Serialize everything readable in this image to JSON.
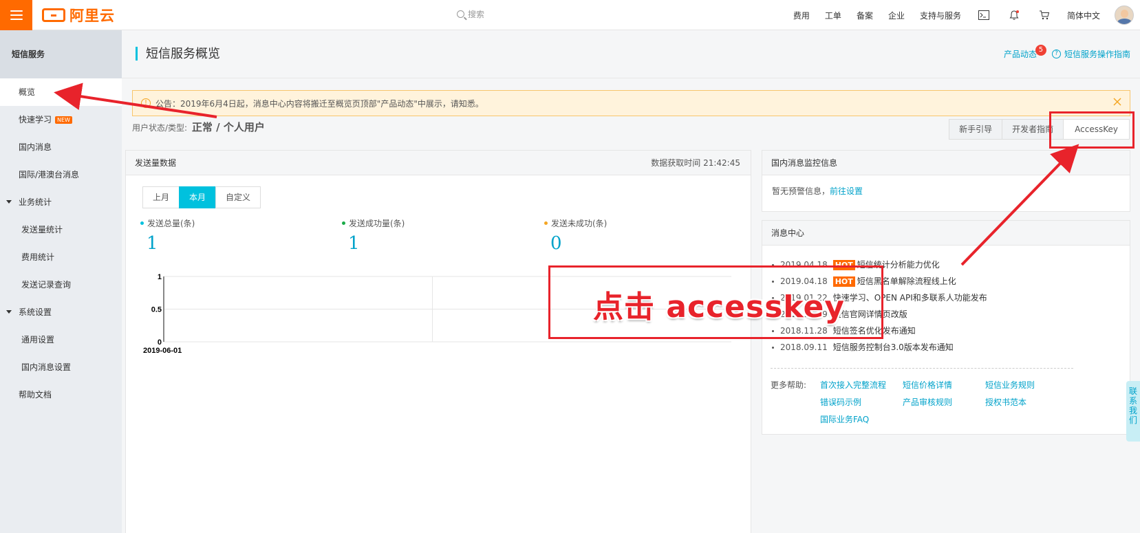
{
  "topbar": {
    "logo_text": "阿里云",
    "search_placeholder": "搜索",
    "nav": [
      "费用",
      "工单",
      "备案",
      "企业",
      "支持与服务"
    ],
    "language": "简体中文",
    "icons": [
      "terminal-icon",
      "bell-icon",
      "cart-icon"
    ]
  },
  "sidebar": {
    "title": "短信服务",
    "items": [
      {
        "label": "概览",
        "active": true
      },
      {
        "label": "快速学习",
        "badge": "NEW"
      },
      {
        "label": "国内消息"
      },
      {
        "label": "国际/港澳台消息"
      },
      {
        "label": "业务统计",
        "group": true
      },
      {
        "label": "发送量统计"
      },
      {
        "label": "费用统计"
      },
      {
        "label": "发送记录查询"
      },
      {
        "label": "系统设置",
        "group": true
      },
      {
        "label": "通用设置"
      },
      {
        "label": "国内消息设置"
      },
      {
        "label": "帮助文档"
      }
    ]
  },
  "page": {
    "title": "短信服务概览",
    "product_news": "产品动态",
    "product_news_count": "5",
    "guide_link": "短信服务操作指南"
  },
  "notice": {
    "text": "公告：2019年6月4日起，消息中心内容将搬迁至概览页顶部\"产品动态\"中展示，请知悉。"
  },
  "user_status": {
    "label": "用户状态/类型:",
    "value": "正常 / 个人用户"
  },
  "buttons": [
    "新手引导",
    "开发者指南",
    "AccessKey"
  ],
  "send_panel": {
    "title": "发送量数据",
    "fetch_time": "数据获取时间 21:42:45",
    "tabs": [
      {
        "label": "上月",
        "selected": false
      },
      {
        "label": "本月",
        "selected": true
      },
      {
        "label": "自定义",
        "selected": false
      }
    ],
    "stats": [
      {
        "label": "发送总量(条)",
        "value": "1",
        "color": "#00c1de"
      },
      {
        "label": "发送成功量(条)",
        "value": "1",
        "color": "#1aab48"
      },
      {
        "label": "发送未成功(条)",
        "value": "0",
        "color": "#f4a623"
      }
    ]
  },
  "chart_data": {
    "type": "line",
    "x": [
      "2019-06-01"
    ],
    "y_ticks": [
      "1",
      "0.5",
      "0"
    ],
    "ylim": [
      0,
      1
    ],
    "series": [
      {
        "values": [
          1
        ]
      }
    ]
  },
  "monitor_panel": {
    "title": "国内消息监控信息",
    "text": "暂无预警信息，",
    "link": "前往设置"
  },
  "message_panel": {
    "title": "消息中心",
    "items": [
      {
        "date": "2019.04.18",
        "hot": "HOT",
        "text": "短信统计分析能力优化"
      },
      {
        "date": "2019.04.18",
        "hot": "HOT",
        "text": "短信黑名单解除流程线上化"
      },
      {
        "date": "2019.01.22",
        "text": "快速学习、OPEN API和多联系人功能发布"
      },
      {
        "date": "2018.12.29",
        "text": "短信官网详情页改版"
      },
      {
        "date": "2018.11.28",
        "text": "短信签名优化发布通知"
      },
      {
        "date": "2018.09.11",
        "text": "短信服务控制台3.0版本发布通知"
      }
    ],
    "more_help_label": "更多帮助:",
    "help_links": [
      "首次接入完整流程",
      "短信价格详情",
      "短信业务规则",
      "错误码示例",
      "产品审核规则",
      "授权书范本",
      "国际业务FAQ"
    ]
  },
  "contact": "联系我们",
  "annotation": {
    "text": "点击 accesskey",
    "color": "#e8232b"
  }
}
